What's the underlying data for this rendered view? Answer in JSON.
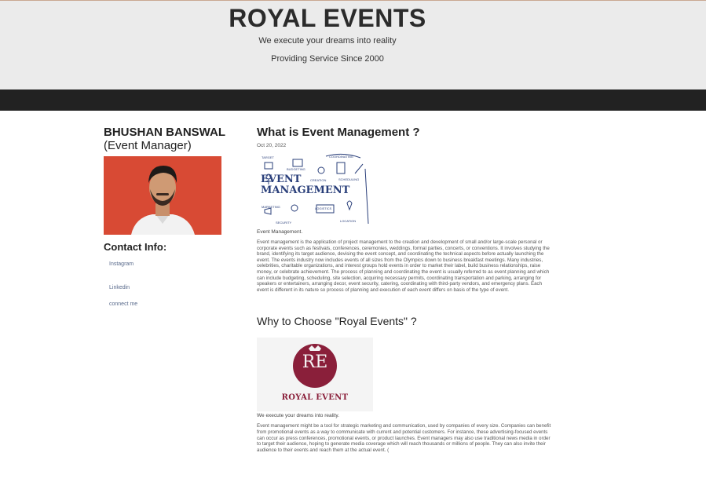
{
  "header": {
    "title": "ROYAL EVENTS",
    "tagline1": "We execute your dreams into reality",
    "tagline2": "Providing Service Since 2000"
  },
  "sidebar": {
    "name": "BHUSHAN BANSWAL",
    "role": "(Event Manager)",
    "contact_title": "Contact Info:",
    "links": [
      "Instagram",
      "Linkedin",
      "connect me"
    ]
  },
  "post": {
    "title": "What is Event Management ?",
    "date": "Oct 20, 2022",
    "image_words": {
      "main1": "EVENT",
      "main2": "MANAGEMENT",
      "small": [
        "TARGET",
        "BUDGETING",
        "CREATION",
        "COORDINATING",
        "SCHEDULING",
        "MARKETING",
        "SECURITY",
        "LOGISTICS",
        "LOCATION"
      ]
    },
    "caption": "Event Management.",
    "body": "Event management is the application of project management to the creation and development of small and/or large-scale personal or corporate events such as festivals, conferences, ceremonies, weddings, formal parties, concerts, or conventions. It involves studying the brand, identifying its target audience, devising the event concept, and coordinating the technical aspects before actually launching the event. The events industry now includes events of all sizes from the Olympics down to business breakfast meetings. Many industries, celebrities, charitable organizations, and interest groups hold events in order to market their label, build business relationships, raise money, or celebrate achievement. The process of planning and coordinating the event is usually referred to as event planning and which can include budgeting, scheduling, site selection, acquiring necessary permits, coordinating transportation and parking, arranging for speakers or entertainers, arranging decor, event security, catering, coordinating with third-party vendors, and emergency plans. Each event is different in its nature so process of planning and execution of each event differs on basis of the type of event."
  },
  "why": {
    "title": "Why to Choose \"Royal Events\" ?",
    "logo_monogram": "RE",
    "logo_text": "ROYAL EVENT",
    "caption": "We execute your dreams into reality.",
    "body": "Event management might be a tool for strategic marketing and communication, used by companies of every size. Companies can benefit from promotional events as a way to communicate with current and potential customers. For instance, these advertising-focused events can occur as press conferences, promotional events, or product launches. Event managers may also use traditional news media in order to target their audience, hoping to generate media coverage which will reach thousands or millions of people. They can also invite their audience to their events and reach them at the actual event. ("
  },
  "colors": {
    "header_bg": "#ebebeb",
    "nav_bg": "#222222",
    "link": "#5a6b8c",
    "photo_bg": "#d84a34",
    "logo_maroon": "#8a1f3a",
    "sketch_blue": "#2a3f7a"
  }
}
